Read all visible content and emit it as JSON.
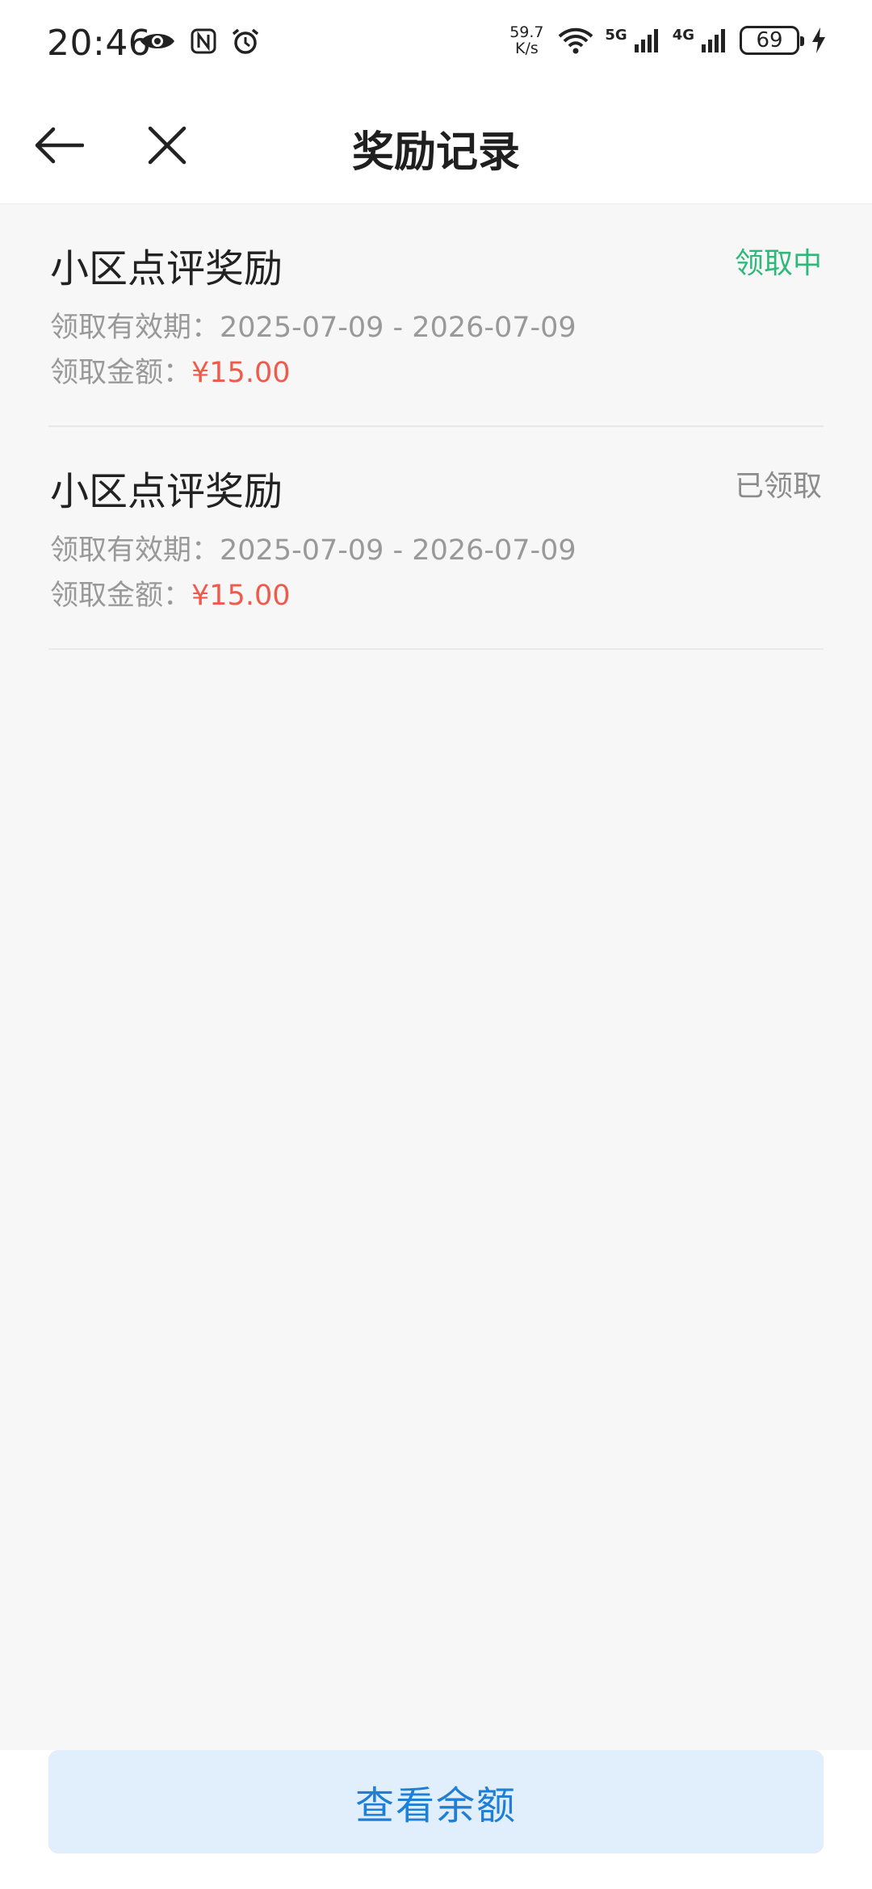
{
  "status_bar": {
    "time": "20:46",
    "net_speed_value": "59.7",
    "net_speed_unit": "K/s",
    "signal_1_label": "5G",
    "signal_2_label": "4G",
    "battery_level": "69",
    "icons": [
      "eye-icon",
      "nfc-icon",
      "alarm-icon",
      "wifi-icon",
      "signal-icon",
      "battery-icon",
      "charging-icon"
    ]
  },
  "header": {
    "title": "奖励记录",
    "back_icon": "arrow-left-icon",
    "close_icon": "close-icon"
  },
  "rewards": [
    {
      "title": "小区点评奖励",
      "status": "领取中",
      "period_label": "领取有效期：",
      "period_value": "2025-07-09 - 2026-07-09",
      "amount_label": "领取金额：",
      "amount_value": "¥15.00"
    },
    {
      "title": "小区点评奖励",
      "status": "已领取",
      "period_label": "领取有效期：",
      "period_value": "2025-07-09 - 2026-07-09",
      "amount_label": "领取金额：",
      "amount_value": "¥15.00"
    }
  ],
  "footer": {
    "balance_button_label": "查看余额"
  },
  "colors": {
    "status_active": "#2fb87a",
    "status_done": "#8c8c8c",
    "amount": "#f05a4b",
    "button_bg": "#e1eefb",
    "button_text": "#1f7fd4"
  }
}
